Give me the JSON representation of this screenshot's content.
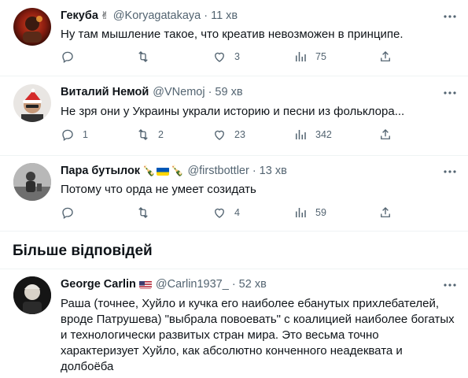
{
  "tweets": [
    {
      "name": "Гекуба",
      "name_emoji": "✌️",
      "handle": "@Koryagatakaya",
      "dot": "·",
      "time": "11 хв",
      "text": "Ну там мышление такое, что креатив невозможен в принципе.",
      "replies": "",
      "retweets": "",
      "likes": "3",
      "views": "75"
    },
    {
      "name": "Виталий Немой",
      "handle": "@VNemoj",
      "dot": "·",
      "time": "59 хв",
      "text": "Не зря они у Украины украли историю и песни из фольклора...",
      "replies": "1",
      "retweets": "2",
      "likes": "23",
      "views": "342"
    },
    {
      "name": "Пара бутылок",
      "name_emoji_left": "🍾",
      "name_emoji_right": "🍾",
      "handle": "@firstbottler",
      "dot": "·",
      "time": "13 хв",
      "text": "Потому что орда не умеет созидать",
      "replies": "",
      "retweets": "",
      "likes": "4",
      "views": "59"
    }
  ],
  "section": {
    "title": "Більше відповідей"
  },
  "more_tweet": {
    "name": "George Carlin",
    "handle": "@Carlin1937_",
    "dot": "·",
    "time": "52 хв",
    "lines": [
      "Раша (точнее, Хуйло и кучка его наиболее ебанутых прихлебателей,",
      "вроде Патрушева) \"выбрала повоевать\" с коалицией наиболее богатых",
      "и технологически развитых стран мира. Это весьма точно",
      "характеризует Хуйло, как абсолютно конченного неадеквата и",
      "долбоёба"
    ]
  },
  "colors": {
    "text": "#0f1419",
    "muted": "#536471",
    "separator": "#eff3f4"
  },
  "icons": [
    "reply-icon",
    "retweet-icon",
    "like-icon",
    "views-icon",
    "share-icon",
    "more-icon"
  ]
}
